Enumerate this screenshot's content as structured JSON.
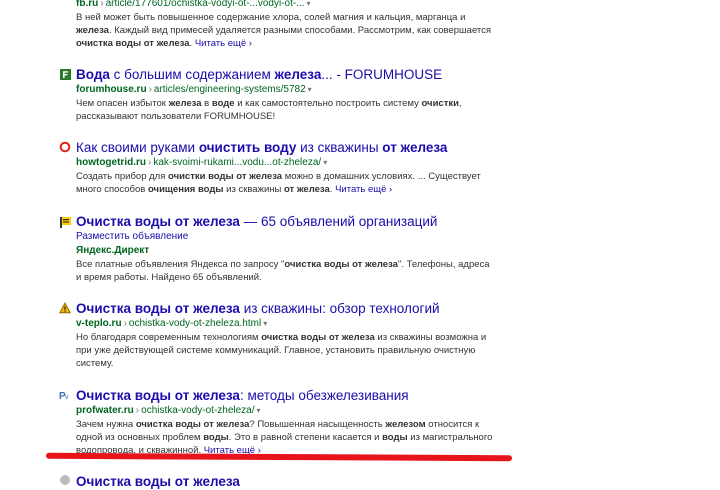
{
  "results": [
    {
      "id": "fb",
      "title_parts": [],
      "url_domain": "fb.ru",
      "url_path": "article/177601/ochistka-vodyi-ot-...vodyi-ot-...",
      "snippet_parts": [
        {
          "t": "В ней может быть повышенное содержание хлора, солей магния и кальция, марганца и "
        },
        {
          "t": "железа",
          "b": true
        },
        {
          "t": ". Каждый вид примесей удаляется разными способами. Рассмотрим, как совершается "
        },
        {
          "t": "очистка воды от железа",
          "b": true
        },
        {
          "t": ". "
        }
      ],
      "more": "Читать ещё ›"
    },
    {
      "id": "forumhouse",
      "icon": "f-letter-icon",
      "title_parts": [
        {
          "t": "Вода",
          "b": true
        },
        {
          "t": " с большим содержанием "
        },
        {
          "t": "железа",
          "b": true
        },
        {
          "t": "... - FORUMHOUSE"
        }
      ],
      "url_domain": "forumhouse.ru",
      "url_path": "articles/engineering-systems/5782",
      "snippet_parts": [
        {
          "t": "Чем опасен избыток "
        },
        {
          "t": "железа",
          "b": true
        },
        {
          "t": " в "
        },
        {
          "t": "воде",
          "b": true
        },
        {
          "t": " и как самостоятельно построить систему "
        },
        {
          "t": "очистки",
          "b": true
        },
        {
          "t": ", рассказывают пользователи FORUMHOUSE!"
        }
      ],
      "more": ""
    },
    {
      "id": "howtogetrid",
      "icon": "red-circle-icon",
      "title_parts": [
        {
          "t": "Как своими руками "
        },
        {
          "t": "очистить воду",
          "b": true
        },
        {
          "t": " из скважины "
        },
        {
          "t": "от железа",
          "b": true
        }
      ],
      "url_domain": "howtogetrid.ru",
      "url_path": "kak-svoimi-rukami...vodu...ot-zheleza/",
      "snippet_parts": [
        {
          "t": "Создать прибор для "
        },
        {
          "t": "очистки воды от железа",
          "b": true
        },
        {
          "t": " можно в домашних условиях. ... Существует много способов "
        },
        {
          "t": "очищения воды",
          "b": true
        },
        {
          "t": " из скважины "
        },
        {
          "t": "от железа",
          "b": true
        },
        {
          "t": ". "
        }
      ],
      "more": "Читать ещё ›"
    },
    {
      "id": "direct",
      "icon": "yellow-flag-icon",
      "title_parts": [
        {
          "t": "Очистка воды от железа",
          "b": true
        },
        {
          "t": " — 65 объявлений организаций"
        }
      ],
      "ad_link": "Разместить объявление",
      "ad_label": "Яндекс.Директ",
      "snippet_parts": [
        {
          "t": "Все платные объявления Яндекса по запросу \""
        },
        {
          "t": "очистка воды от железа",
          "b": true
        },
        {
          "t": "\". Телефоны, адреса и время работы. Найдено 65 объявлений."
        }
      ],
      "more": ""
    },
    {
      "id": "vteplo",
      "icon": "warning-triangle-icon",
      "title_parts": [
        {
          "t": "Очистка воды от железа",
          "b": true
        },
        {
          "t": " из скважины: обзор технологий"
        }
      ],
      "url_domain": "v-teplo.ru",
      "url_path": "ochistka-vody-ot-zheleza.html",
      "snippet_parts": [
        {
          "t": "Но благодаря современным технологиям "
        },
        {
          "t": "очистка воды от железа",
          "b": true
        },
        {
          "t": " из скважины возможна и при уже действующей системе коммуникаций. Главное, установить правильную очистную систему."
        }
      ],
      "more": ""
    },
    {
      "id": "profwater",
      "icon": "pw-logo-icon",
      "title_parts": [
        {
          "t": "Очистка воды от железа",
          "b": true
        },
        {
          "t": ": методы обезжелезивания"
        }
      ],
      "url_domain": "profwater.ru",
      "url_path": "ochistka-vody-ot-zheleza/",
      "snippet_parts": [
        {
          "t": "Зачем нужна "
        },
        {
          "t": "очистка воды от железа",
          "b": true
        },
        {
          "t": "? Повышенная насыщенность "
        },
        {
          "t": "железом",
          "b": true
        },
        {
          "t": " относится к одной из основных проблем "
        },
        {
          "t": "воды",
          "b": true
        },
        {
          "t": ". Это в равной степени касается и "
        },
        {
          "t": "воды",
          "b": true
        },
        {
          "t": " из магистрального водопровода, и скважинной. "
        }
      ],
      "more": "Читать ещё ›"
    },
    {
      "id": "partial",
      "icon": "partial-icon",
      "title_parts": [
        {
          "t": "Очистка воды от железа",
          "b": true
        }
      ]
    }
  ],
  "colors": {
    "link": "#1a0dab",
    "url": "#006621",
    "annotation": "#e8141b"
  }
}
